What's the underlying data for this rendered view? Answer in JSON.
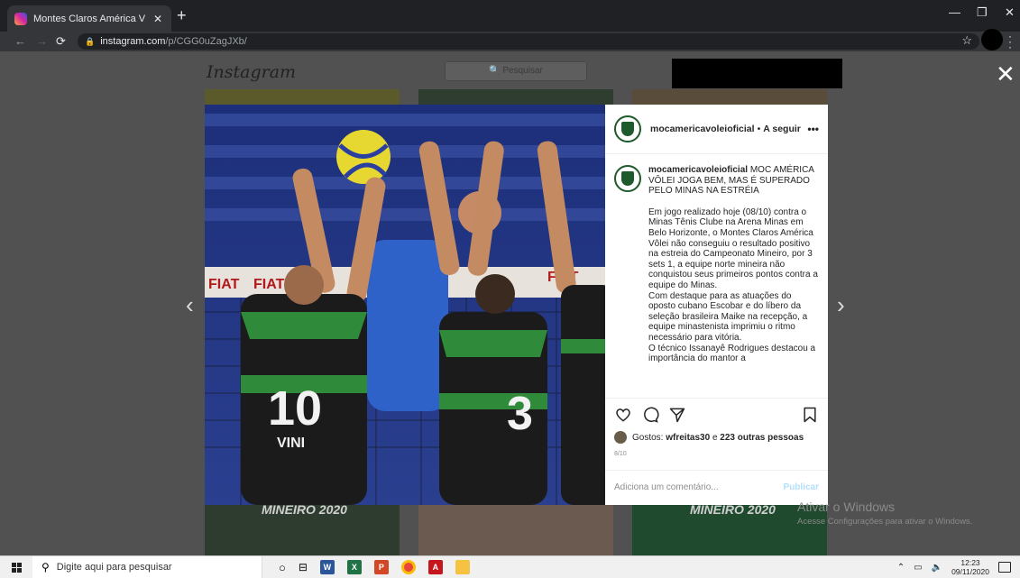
{
  "browser": {
    "tab_title": "Montes Claros América Vôlei (@m",
    "tab_close": "✕",
    "new_tab": "+",
    "url_host": "instagram.com",
    "url_path": "/p/CGG0uZagJXb/",
    "window_controls": [
      "—",
      "❐",
      "✕"
    ]
  },
  "instagram": {
    "logo": "Instagram",
    "search_placeholder": "🔍 Pesquisar",
    "close": "✕",
    "bg_caption_left": "MINEIRO 2020",
    "bg_caption_right": "MINEIRO 2020",
    "prev_arrow": "‹",
    "next_arrow": "›"
  },
  "post": {
    "username": "mocamericavoleioficial",
    "header_separator": "•",
    "follow_label": "A seguir",
    "more": "•••",
    "caption_title": "MOC AMÉRICA VÔLEI JOGA BEM, MAS É SUPERADO PELO MINAS NA ESTRÉIA",
    "caption_paragraphs": [
      "Em jogo realizado hoje (08/10) contra o Minas Tênis Clube na Arena Minas em Belo Horizonte, o Montes Claros América Vôlei não conseguiu o resultado positivo na estreia do Campeonato Mineiro, por 3 sets 1, a equipe norte mineira não conquistou seus primeiros pontos contra a equipe do Minas.",
      "Com destaque para as atuações do oposto cubano Escobar e do líbero da seleção brasileira Maike na recepção, a equipe minastenista imprimiu o ritmo necessário para vitória.",
      "O técnico Issanayê Rodrigues destacou a importância do mantor a"
    ],
    "likes_prefix": "Gostos:",
    "likes_user": "wfreitas30",
    "likes_middle": "e",
    "likes_others": "223 outras pessoas",
    "date": "8/10",
    "comment_placeholder": "Adiciona um comentário...",
    "publish_label": "Publicar"
  },
  "photo_text": {
    "jersey_left_number": "10",
    "jersey_left_name": "VINI",
    "jersey_right_number": "3",
    "net_brand": "FIAT"
  },
  "windows_watermark": {
    "title": "Ativar o Windows",
    "subtitle": "Acesse Configurações para ativar o Windows."
  },
  "taskbar": {
    "search_placeholder": "Digite aqui para pesquisar",
    "time": "12:23",
    "date": "09/11/2020"
  }
}
